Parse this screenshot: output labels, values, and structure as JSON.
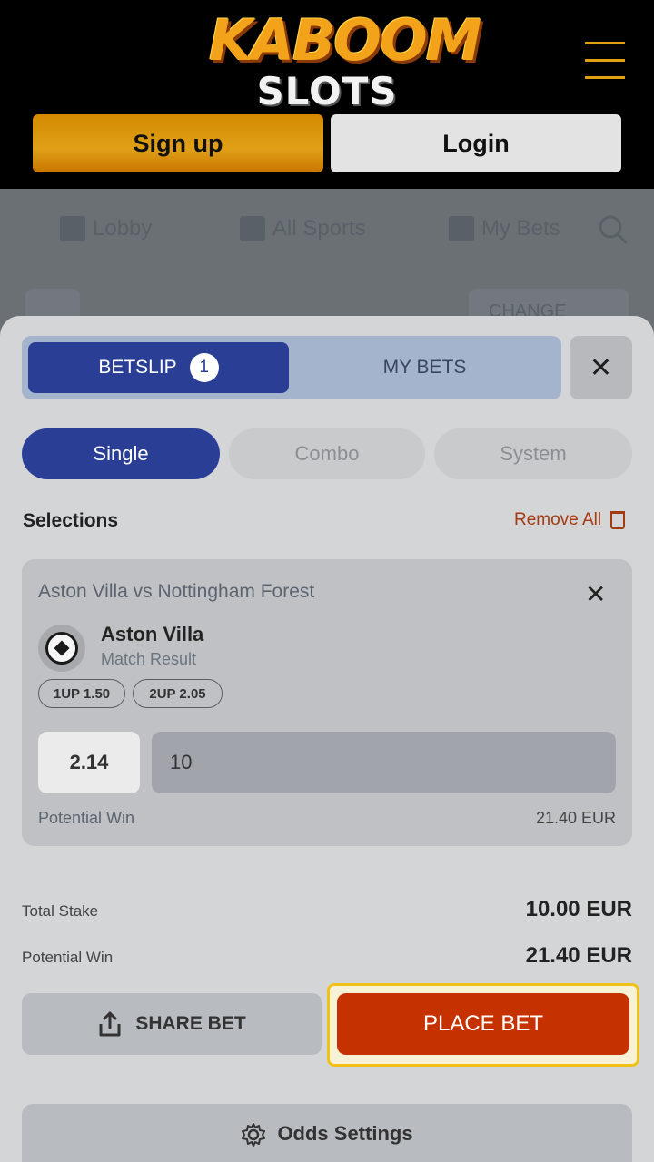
{
  "header": {
    "logo_top": "KABOOM",
    "logo_bottom": "SLOTS",
    "signup_label": "Sign up",
    "login_label": "Login"
  },
  "background_nav": {
    "items": [
      {
        "label": "Lobby",
        "icon": "home-icon"
      },
      {
        "label": "All Sports",
        "icon": "list-icon"
      },
      {
        "label": "My Bets",
        "icon": "clipboard-icon"
      }
    ],
    "change_label": "CHANGE"
  },
  "betslip": {
    "tab_betslip": "BETSLIP",
    "betslip_count": "1",
    "tab_mybets": "MY BETS",
    "modes": [
      "Single",
      "Combo",
      "System"
    ],
    "active_mode": "Single",
    "selections_title": "Selections",
    "remove_all": "Remove All",
    "selection": {
      "match": "Aston Villa vs Nottingham Forest",
      "team": "Aston Villa",
      "market": "Match Result",
      "chips": [
        "1UP 1.50",
        "2UP 2.05"
      ],
      "odds": "2.14",
      "stake": "10",
      "potential_win_label": "Potential Win",
      "potential_win_value": "21.40 EUR"
    },
    "total_stake_label": "Total Stake",
    "total_stake_value": "10.00 EUR",
    "potential_win_label": "Potential Win",
    "potential_win_value": "21.40 EUR",
    "share_label": "SHARE BET",
    "place_label": "PLACE BET",
    "odds_settings_label": "Odds Settings"
  },
  "colors": {
    "primary_blue": "#2b3e96",
    "place_bet": "#c53200",
    "highlight": "#f2c21a",
    "signup_gold": "#e0a018"
  }
}
